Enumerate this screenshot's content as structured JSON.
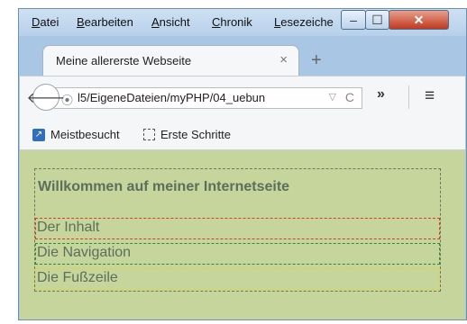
{
  "menubar": {
    "items": [
      {
        "label_before": "",
        "mnemonic": "D",
        "label_after": "atei"
      },
      {
        "label_before": "",
        "mnemonic": "B",
        "label_after": "earbeiten"
      },
      {
        "label_before": "",
        "mnemonic": "A",
        "label_after": "nsicht"
      },
      {
        "label_before": "",
        "mnemonic": "C",
        "label_after": "hronik"
      },
      {
        "label_before": "",
        "mnemonic": "L",
        "label_after": "esezeiche"
      }
    ]
  },
  "window_controls": {
    "minimize": "–",
    "maximize": "☐",
    "close": "✕"
  },
  "tab": {
    "title": "Meine allererste Webseite",
    "close_glyph": "×",
    "new_tab_glyph": "+"
  },
  "navbar": {
    "back_glyph": "🡐",
    "url": "l5/EigeneDateien/myPHP/04_uebun",
    "dropdown_glyph": "▽",
    "reload_glyph": "C",
    "overflow_glyph": "»",
    "menu_glyph": "≡"
  },
  "bookmarks": {
    "items": [
      {
        "label": "Meistbesucht",
        "icon": "most-visited-icon"
      },
      {
        "label": "Erste Schritte",
        "icon": "first-steps-icon"
      }
    ]
  },
  "page": {
    "header": "Willkommen auf meiner Internetseite",
    "sections": [
      {
        "label": "Der Inhalt",
        "color": "#e03a2a"
      },
      {
        "label": "Die Navigation",
        "color": "#2e8b2e"
      },
      {
        "label": "Die Fußzeile",
        "color": "#e2d53a"
      }
    ],
    "background": "#c5d59c"
  }
}
